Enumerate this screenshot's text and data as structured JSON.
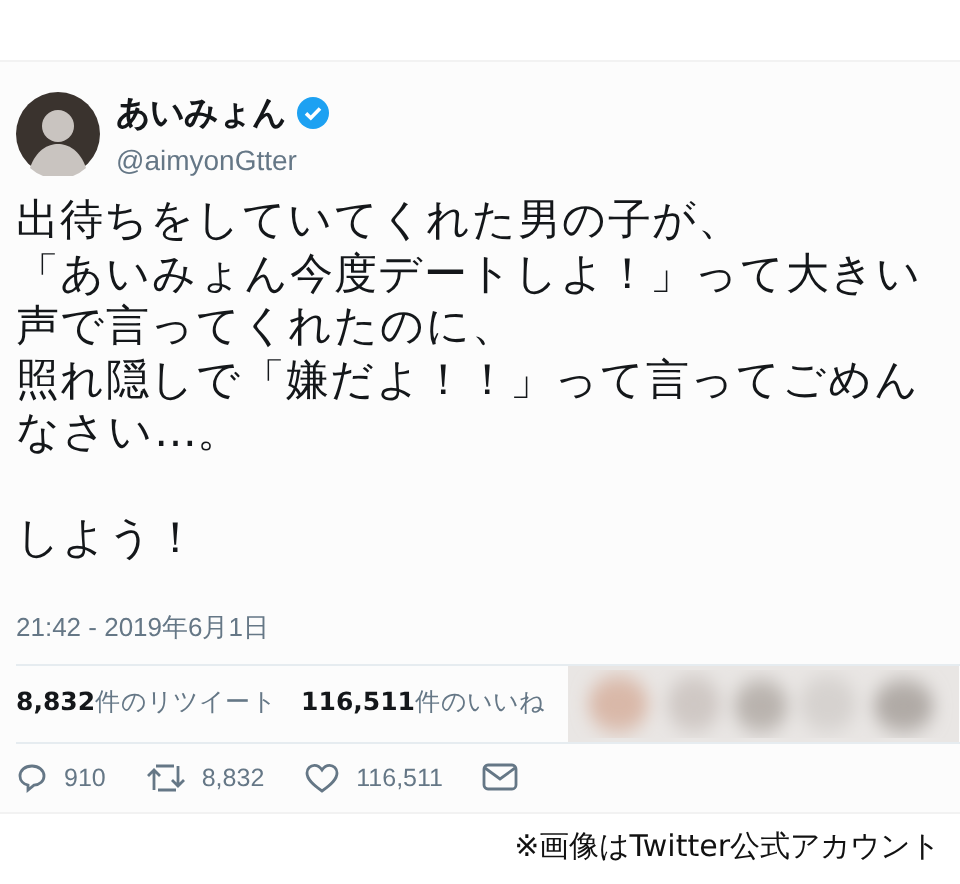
{
  "tweet": {
    "name": "あいみょん",
    "verified": true,
    "handle": "@aimyonGtter",
    "paragraphs": [
      [
        "出待ちをしていてくれた男の子が、",
        "「あいみょん今度デートしよ！」って大きい",
        "声で言ってくれたのに、",
        "照れ隠しで「嫌だよ！！」って言ってごめん",
        "なさい…。"
      ],
      [
        "しよう！"
      ]
    ],
    "timestamp": "21:42 - 2019年6月1日",
    "stats": [
      "**8,832**件のリツイート",
      "**116,511**件のいいね"
    ],
    "actions": [
      {
        "kind": "reply",
        "count": "910"
      },
      {
        "kind": "retweet",
        "count": "8,832"
      },
      {
        "kind": "like",
        "count": "116,511"
      },
      {
        "kind": "message"
      }
    ]
  },
  "caption": "※画像はTwitter公式アカウント"
}
